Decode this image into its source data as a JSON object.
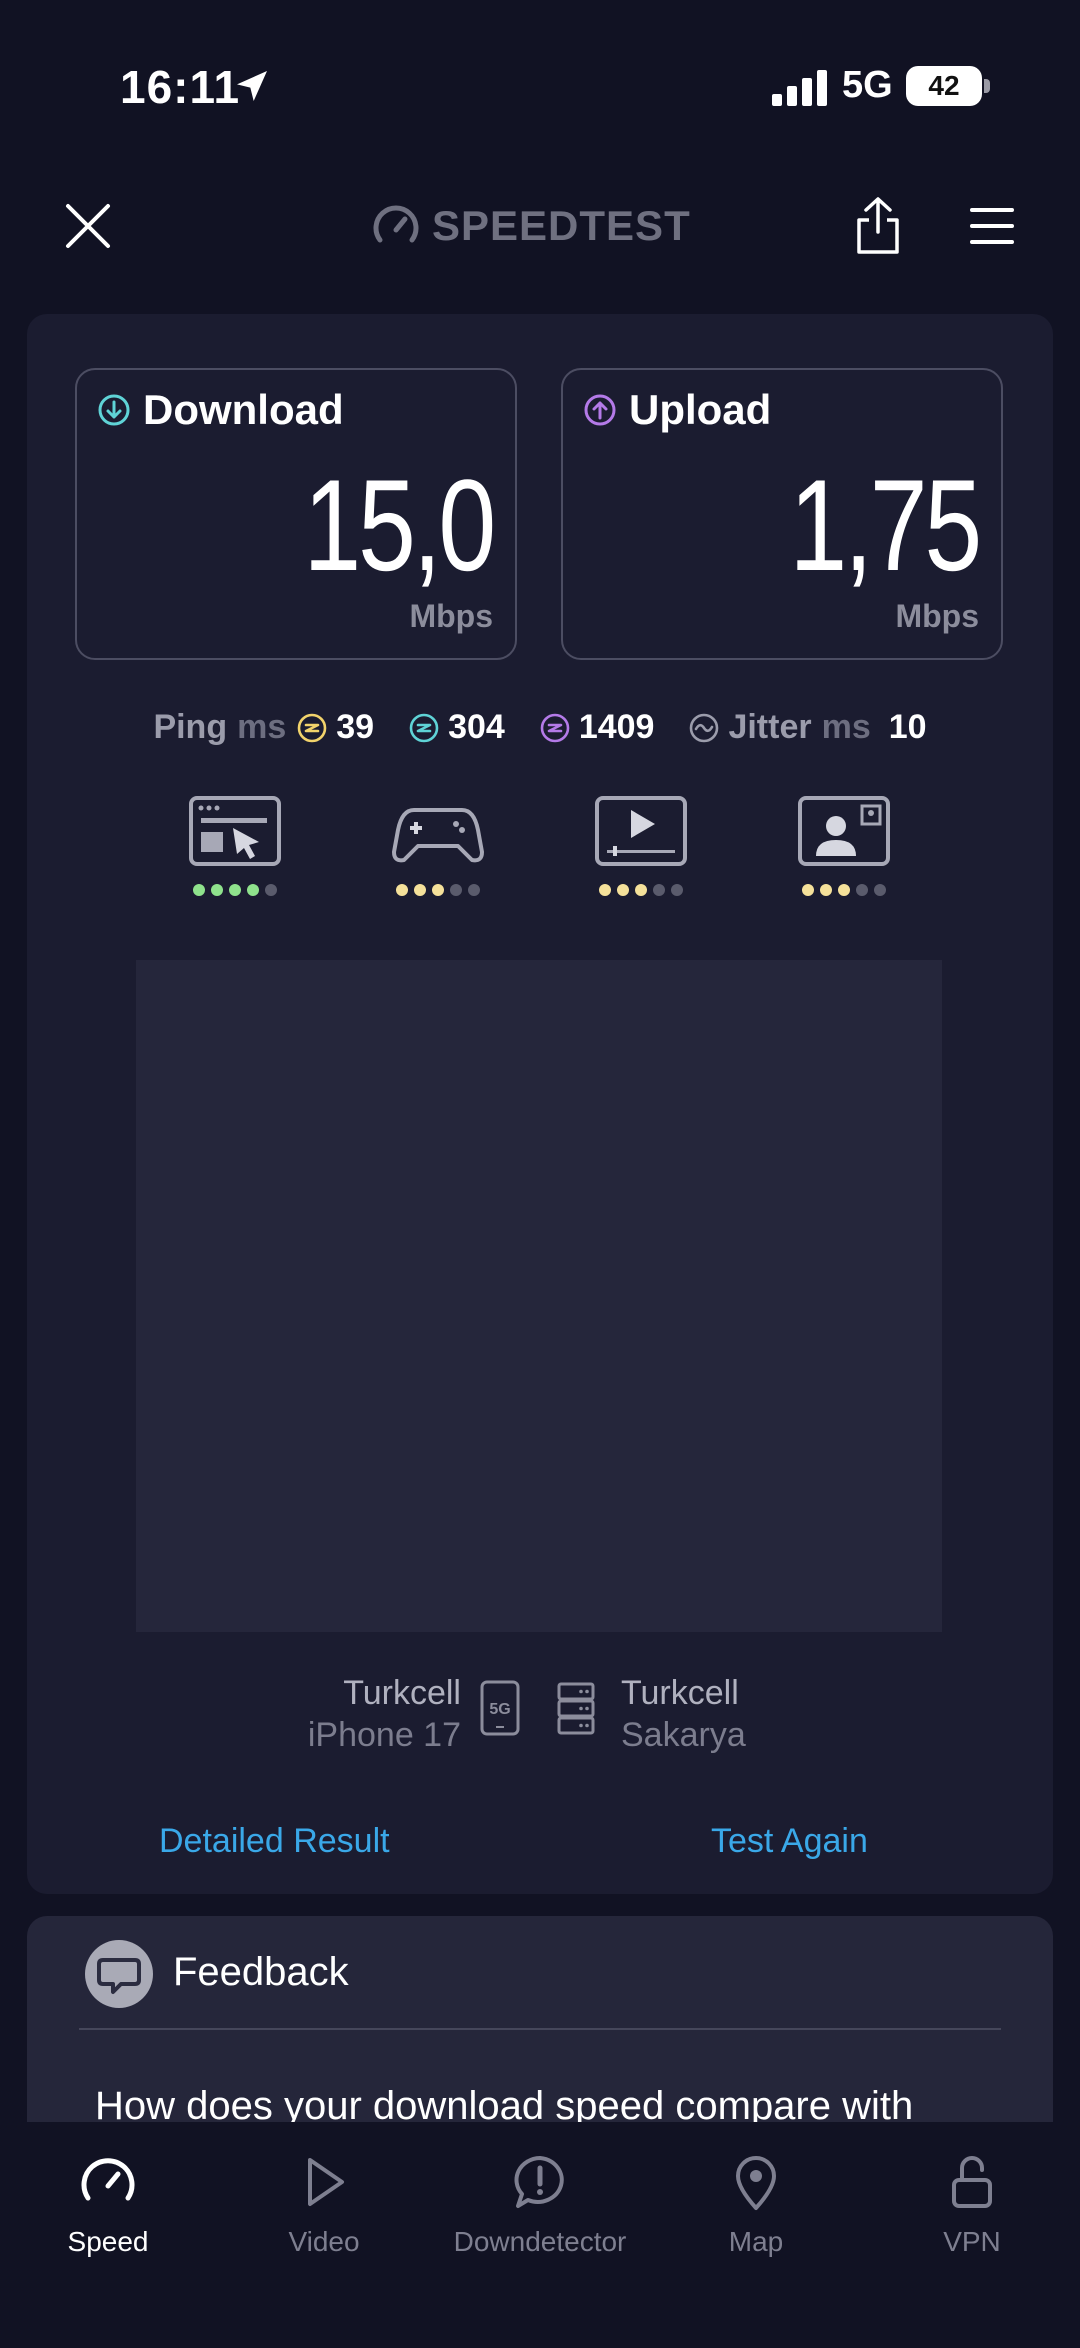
{
  "status_bar": {
    "time": "16:11",
    "network": "5G",
    "battery": "42"
  },
  "header": {
    "logo_text": "SPEEDTEST"
  },
  "results": {
    "download": {
      "label": "Download",
      "value": "15,0",
      "unit": "Mbps"
    },
    "upload": {
      "label": "Upload",
      "value": "1,75",
      "unit": "Mbps"
    }
  },
  "ping": {
    "label": "Ping",
    "unit": "ms",
    "idle": "39",
    "download": "304",
    "upload": "1409",
    "jitter_label": "Jitter",
    "jitter_unit": "ms",
    "jitter": "10"
  },
  "experience": [
    {
      "icon": "web-browsing-icon",
      "rating": 4
    },
    {
      "icon": "gaming-icon",
      "rating": 3
    },
    {
      "icon": "video-streaming-icon",
      "rating": 3
    },
    {
      "icon": "video-call-icon",
      "rating": 3
    }
  ],
  "connection": {
    "provider": "Turkcell",
    "device": "iPhone 17",
    "server_provider": "Turkcell",
    "server_city": "Sakarya"
  },
  "actions": {
    "detailed": "Detailed Result",
    "again": "Test Again"
  },
  "feedback": {
    "title": "Feedback",
    "question": "How does your download speed compare with"
  },
  "nav": {
    "speed": "Speed",
    "video": "Video",
    "downdetector": "Downdetector",
    "map": "Map",
    "vpn": "VPN"
  },
  "colors": {
    "background": "#111223",
    "card": "#1b1c30",
    "accent_link": "#3aa8e8",
    "download_icon": "#5fd3d6",
    "upload_icon": "#b47ae8",
    "ping_idle": "#f2d36b",
    "rating_green": "#8fe28c",
    "rating_yellow": "#f5e19a"
  }
}
